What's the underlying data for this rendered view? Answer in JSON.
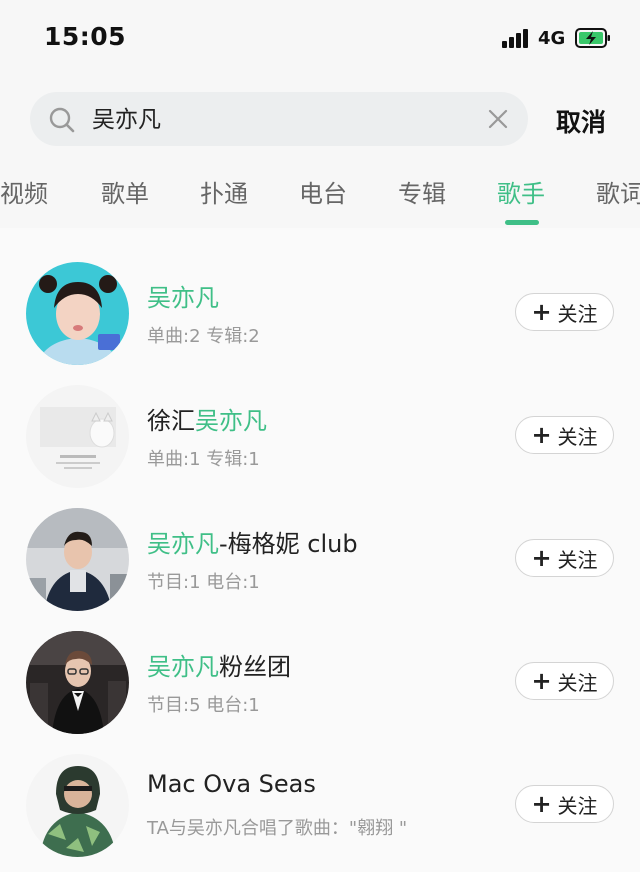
{
  "status": {
    "time": "15:05",
    "network": "4G"
  },
  "search": {
    "query": "吴亦凡",
    "cancel_label": "取消"
  },
  "tabs": [
    {
      "label": "视频"
    },
    {
      "label": "歌单"
    },
    {
      "label": "扑通"
    },
    {
      "label": "电台"
    },
    {
      "label": "专辑"
    },
    {
      "label": "歌手"
    },
    {
      "label": "歌词"
    }
  ],
  "active_tab": "歌手",
  "accent_color": "#3fbf87",
  "results": [
    {
      "name_before": "",
      "name_highlight": "吴亦凡",
      "name_after": "",
      "subtitle": "单曲:2  专辑:2",
      "follow_label": "关注"
    },
    {
      "name_before": "徐汇",
      "name_highlight": "吴亦凡",
      "name_after": "",
      "subtitle": "单曲:1  专辑:1",
      "follow_label": "关注"
    },
    {
      "name_before": "",
      "name_highlight": "吴亦凡",
      "name_after": "-梅格妮 club",
      "subtitle": "节目:1  电台:1",
      "follow_label": "关注"
    },
    {
      "name_before": "",
      "name_highlight": "吴亦凡",
      "name_after": "粉丝团",
      "subtitle": "节目:5  电台:1",
      "follow_label": "关注"
    },
    {
      "name_before": "Mac Ova Seas",
      "name_highlight": "",
      "name_after": "",
      "subtitle": "TA与吴亦凡合唱了歌曲：\"翱翔 \"",
      "follow_label": "关注"
    }
  ]
}
